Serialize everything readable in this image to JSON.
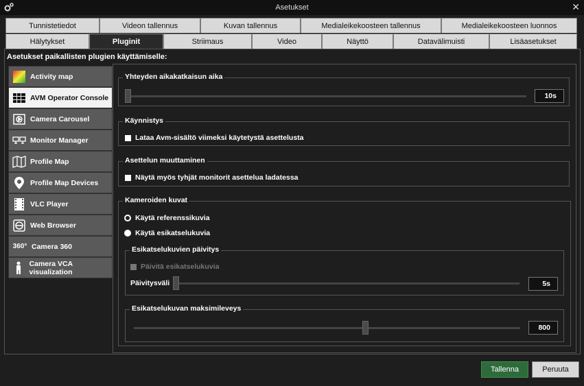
{
  "window": {
    "title": "Asetukset",
    "app_icon": "gear-icon",
    "close_icon": "close-icon"
  },
  "tabs_row1": [
    "Tunnistetiedot",
    "Videon tallennus",
    "Kuvan tallennus",
    "Medialeikekoosteen tallennus",
    "Medialeikekoosteen luonnos"
  ],
  "tabs_row2": [
    "Hälytykset",
    "Pluginit",
    "Striimaus",
    "Video",
    "Näyttö",
    "Datavälimuisti",
    "Lisäasetukset"
  ],
  "active_tab": "Pluginit",
  "heading": "Asetukset paikallisten plugien käyttämiselle:",
  "plugins": [
    {
      "label": "Activity map",
      "icon": "activity-map-icon"
    },
    {
      "label": "AVM Operator Console",
      "icon": "grid-icon"
    },
    {
      "label": "Camera Carousel",
      "icon": "camera-carousel-icon"
    },
    {
      "label": "Monitor Manager",
      "icon": "monitors-icon"
    },
    {
      "label": "Profile Map",
      "icon": "map-icon"
    },
    {
      "label": "Profile Map Devices",
      "icon": "map-pin-icon"
    },
    {
      "label": "VLC Player",
      "icon": "film-icon"
    },
    {
      "label": "Web Browser",
      "icon": "globe-icon"
    },
    {
      "label": "Camera 360",
      "icon": "camera-360-icon",
      "icon_text": "360°"
    },
    {
      "label": "Camera VCA visualization",
      "icon": "person-icon"
    }
  ],
  "active_plugin": "AVM Operator Console",
  "timeout": {
    "title": "Yhteyden aikakatkaisun aika",
    "value": "10s",
    "slider_level": 0.0
  },
  "startup": {
    "title": "Käynnistys",
    "checkbox_label": "Lataa Avm-sisältö viimeksi käytetystä asettelusta",
    "checked": false
  },
  "layout_change": {
    "title": "Asettelun muuttaminen",
    "checkbox_label": "Näytä myös tyhjät monitorit asettelua ladatessa",
    "checked": false
  },
  "camera_images": {
    "title": "Kameroiden kuvat",
    "radio_ref": "Käytä referenssikuvia",
    "radio_preview": "Käytä esikatselukuvia",
    "selected": "radio_preview",
    "preview_update": {
      "title": "Esikatselukuvien päivitys",
      "checkbox_label": "Päivitä esikatselukuvia",
      "interval_label": "Päivitysväli",
      "interval_value": "5s",
      "slider_level": 0.0
    },
    "max_width": {
      "title": "Esikatselukuvan maksimileveys",
      "value": "800",
      "slider_level": 0.6
    }
  },
  "buttons": {
    "save": "Tallenna",
    "cancel": "Peruuta"
  },
  "colors": {
    "save_button": "#2e6b3b",
    "active_item_bg": "#f2f2f2"
  }
}
